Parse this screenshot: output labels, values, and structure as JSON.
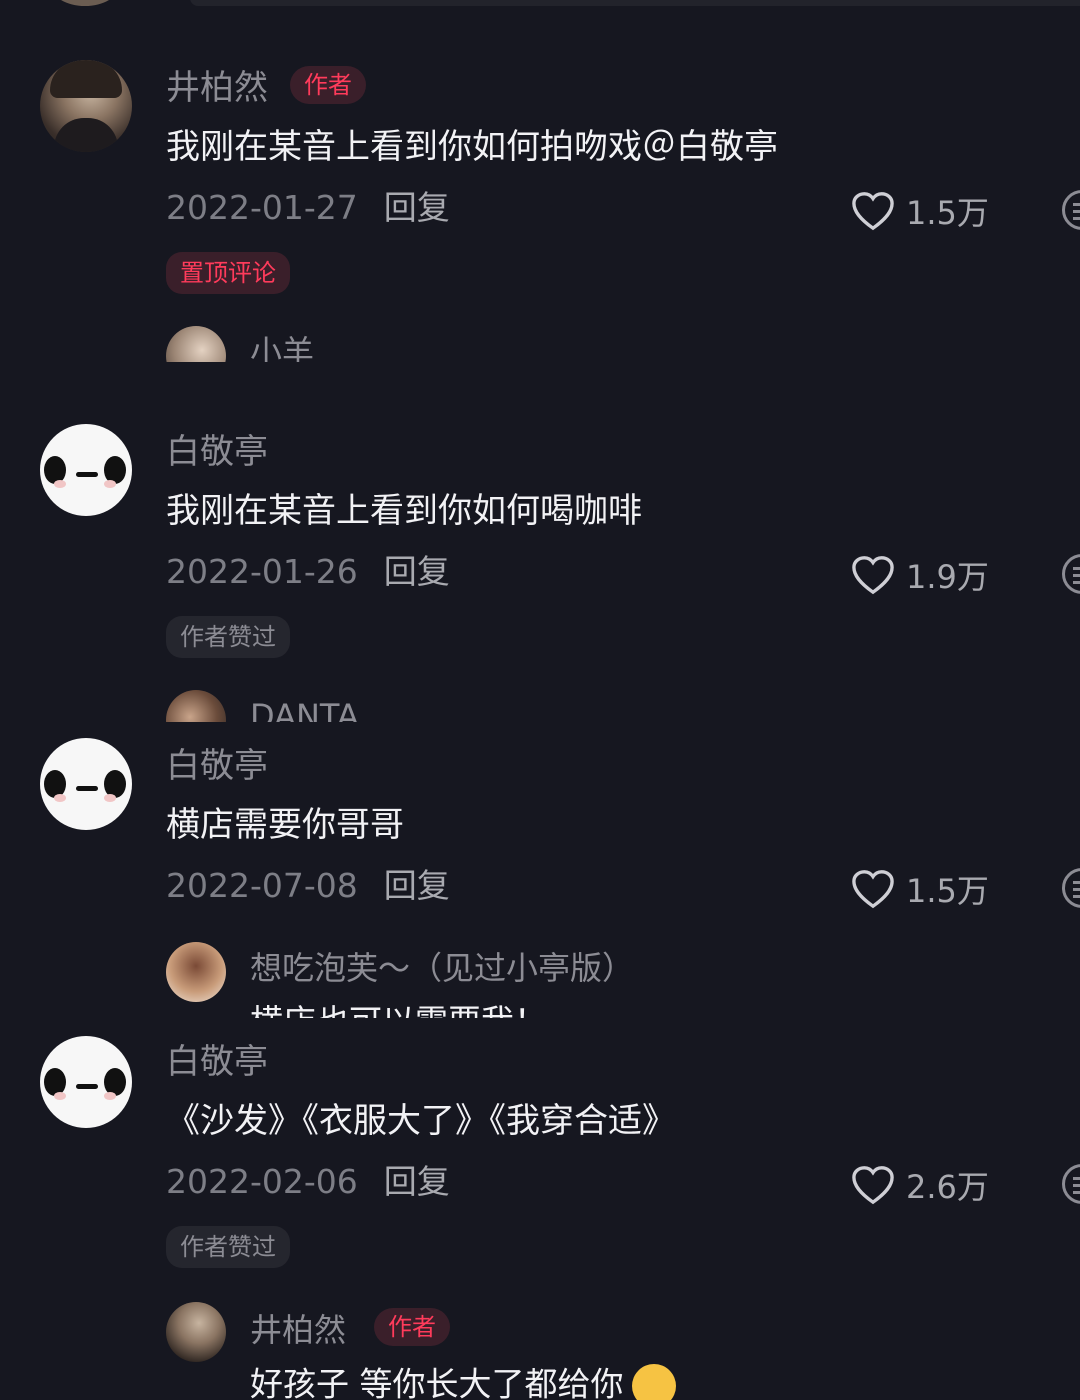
{
  "comments": [
    {
      "name": "井柏然",
      "badge": "作者",
      "text": "我刚在某音上看到你如何拍吻戏＠白敬亭",
      "date": "2022-01-27",
      "reply": "回复",
      "likes": "1.5万",
      "tag": "置顶评论",
      "sub_name": "小羊"
    },
    {
      "name": "白敬亭",
      "text": "我刚在某音上看到你如何喝咖啡",
      "date": "2022-01-26",
      "reply": "回复",
      "likes": "1.9万",
      "tag": "作者赞过",
      "sub_name": "DANTA"
    },
    {
      "name": "白敬亭",
      "text": "横店需要你哥哥",
      "date": "2022-07-08",
      "reply": "回复",
      "likes": "1.5万",
      "sub_name": "想吃泡芙～（见过小亭版）",
      "sub_text": "横店也可以需要我！"
    },
    {
      "name": "白敬亭",
      "text": "《沙发》《衣服大了》《我穿合适》",
      "date": "2022-02-06",
      "reply": "回复",
      "likes": "2.6万",
      "tag": "作者赞过",
      "sub_name": "井柏然",
      "sub_badge": "作者",
      "sub_text": "好孩子 等你长大了都给你"
    }
  ],
  "icons": {
    "like": "heart-outline-icon",
    "more": "more-options-icon",
    "emoji": "upside-down-face-emoji"
  },
  "colors": {
    "background": "#161720",
    "author_badge": "#ff3b5b",
    "text": "#f2f2f5",
    "secondary": "#8c8c94"
  }
}
